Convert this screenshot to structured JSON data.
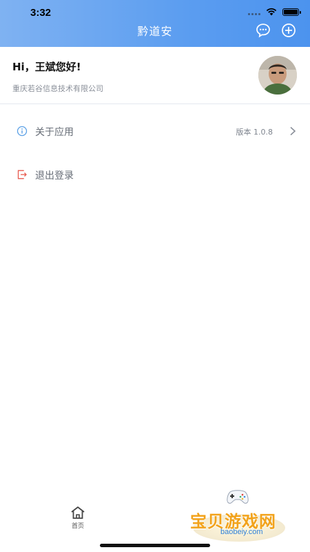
{
  "status_bar": {
    "time": "3:32"
  },
  "header": {
    "title": "黔道安",
    "chat_icon": "chat-bubble-icon",
    "add_icon": "plus-circle-icon",
    "gradient_start": "#7fb2f2",
    "gradient_end": "#4c93ee"
  },
  "profile": {
    "greeting": "Hi，王斌您好!",
    "company": "重庆若谷信息技术有限公司"
  },
  "menu": {
    "about": {
      "label": "关于应用",
      "version": "版本 1.0.8",
      "icon": "info-icon"
    },
    "logout": {
      "label": "退出登录",
      "icon": "logout-icon"
    }
  },
  "tabbar": {
    "home_label": "首页",
    "home_icon": "home-icon"
  },
  "watermark": {
    "text": "宝贝游戏网",
    "url": "baobeiy.com"
  },
  "colors": {
    "accent": "#4c93ee",
    "logout_red": "#e85a4f",
    "info_blue": "#5aa0e6"
  }
}
